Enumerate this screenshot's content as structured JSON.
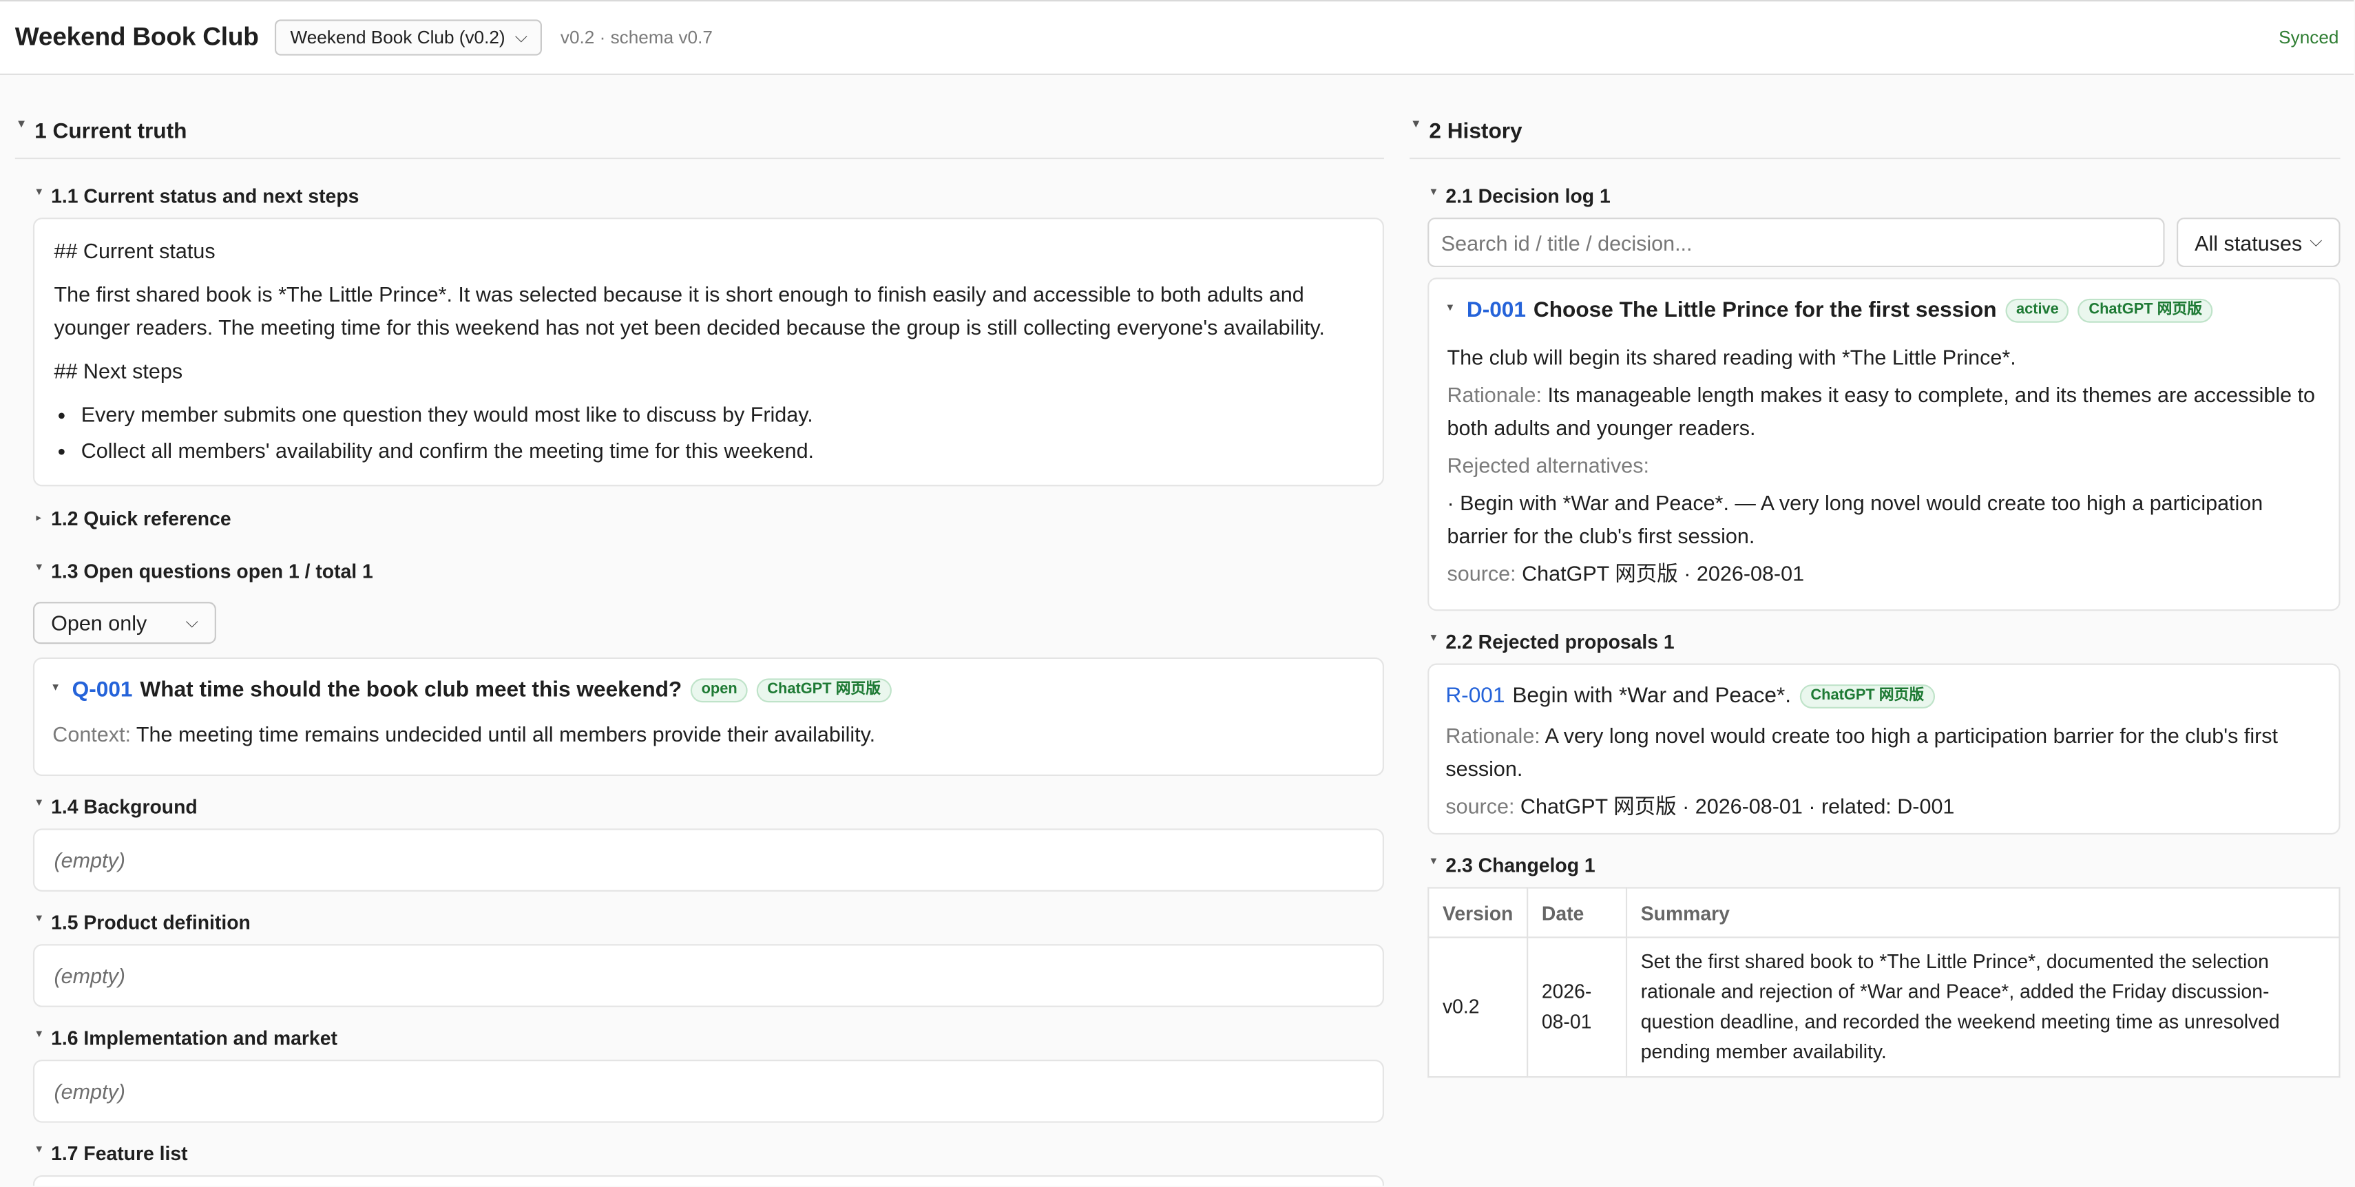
{
  "app": {
    "title": "Weekend Book Club",
    "version_select": "Weekend Book Club (v0.2)",
    "version_meta": "v0.2 · schema v0.7",
    "sync_status": "Synced"
  },
  "current_truth": {
    "heading": "1 Current truth",
    "status_section": {
      "heading": "1.1 Current status and next steps",
      "status_title": "## Current status",
      "status_text": "The first shared book is *The Little Prince*. It was selected because it is short enough to finish easily and accessible to both adults and younger readers. The meeting time for this weekend has not yet been decided because the group is still collecting everyone's availability.",
      "next_title": "## Next steps",
      "next_steps": [
        "Every member submits one question they would most like to discuss by Friday.",
        "Collect all members' availability and confirm the meeting time for this weekend."
      ]
    },
    "quick_reference": {
      "heading": "1.2 Quick reference"
    },
    "open_questions": {
      "heading": "1.3 Open questions open 1 / total 1",
      "filter": "Open only",
      "items": [
        {
          "id": "Q-001",
          "title": "What time should the book club meet this weekend?",
          "status": "open",
          "source": "ChatGPT 网页版",
          "context_label": "Context:",
          "context": "The meeting time remains undecided until all members provide their availability."
        }
      ]
    },
    "background": {
      "heading": "1.4 Background",
      "empty": "(empty)"
    },
    "product_definition": {
      "heading": "1.5 Product definition",
      "empty": "(empty)"
    },
    "implementation": {
      "heading": "1.6 Implementation and market",
      "empty": "(empty)"
    },
    "feature_list": {
      "heading": "1.7 Feature list"
    }
  },
  "history": {
    "heading": "2 History",
    "decision_log": {
      "heading": "2.1 Decision log 1",
      "search_placeholder": "Search id / title / decision...",
      "status_filter": "All statuses",
      "items": [
        {
          "id": "D-001",
          "title": "Choose The Little Prince for the first session",
          "status": "active",
          "source": "ChatGPT 网页版",
          "decision": "The club will begin its shared reading with *The Little Prince*.",
          "rationale_label": "Rationale:",
          "rationale": "Its manageable length makes it easy to complete, and its themes are accessible to both adults and younger readers.",
          "rejected_label": "Rejected alternatives:",
          "rejected": "· Begin with *War and Peace*. — A very long novel would create too high a participation barrier for the club's first session.",
          "source_label": "source:",
          "source_line": "ChatGPT 网页版 · 2026-08-01"
        }
      ]
    },
    "rejected_proposals": {
      "heading": "2.2 Rejected proposals 1",
      "items": [
        {
          "id": "R-001",
          "title": "Begin with *War and Peace*.",
          "source": "ChatGPT 网页版",
          "rationale_label": "Rationale:",
          "rationale": "A very long novel would create too high a participation barrier for the club's first session.",
          "source_label": "source:",
          "source_line": "ChatGPT 网页版 · 2026-08-01 · related: D-001"
        }
      ]
    },
    "changelog": {
      "heading": "2.3 Changelog 1",
      "columns": [
        "Version",
        "Date",
        "Summary"
      ],
      "rows": [
        {
          "version": "v0.2",
          "date": "2026-08-01",
          "summary": "Set the first shared book to *The Little Prince*, documented the selection rationale and rejection of *War and Peace*, added the Friday discussion-question deadline, and recorded the weekend meeting time as unresolved pending member availability."
        }
      ]
    }
  }
}
